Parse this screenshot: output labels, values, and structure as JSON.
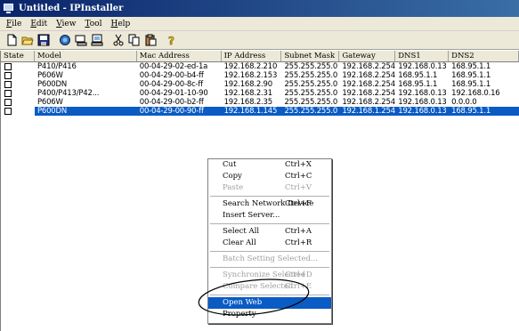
{
  "window": {
    "title": "Untitled - IPInstaller"
  },
  "menu": [
    {
      "label": "File"
    },
    {
      "label": "Edit"
    },
    {
      "label": "View"
    },
    {
      "label": "Tool"
    },
    {
      "label": "Help"
    }
  ],
  "toolbar": {
    "icons": [
      "new-file-icon",
      "open-folder-icon",
      "save-icon",
      "search-network-icon",
      "network-device-icon",
      "network-device-2-icon",
      "cut-icon",
      "copy-icon",
      "paste-icon",
      "help-icon"
    ]
  },
  "table": {
    "headers": [
      "State",
      "Model",
      "Mac Address",
      "IP Address",
      "Subnet Mask",
      "Gateway",
      "DNS1",
      "DNS2"
    ],
    "rows": [
      [
        "P410/P416",
        "00-04-29-02-ed-1a",
        "192.168.2.210",
        "255.255.255.0",
        "192.168.2.254",
        "192.168.0.13",
        "168.95.1.1"
      ],
      [
        "P606W",
        "00-04-29-00-b4-ff",
        "192.168.2.153",
        "255.255.255.0",
        "192.168.2.254",
        "168.95.1.1",
        "168.95.1.1"
      ],
      [
        "P600DN",
        "00-04-29-00-8c-ff",
        "192.168.2.90",
        "255.255.255.0",
        "192.168.2.254",
        "168.95.1.1",
        "168.95.1.1"
      ],
      [
        "P400/P413/P42...",
        "00-04-29-01-10-90",
        "192.168.2.31",
        "255.255.255.0",
        "192.168.2.254",
        "192.168.0.13",
        "192.168.0.16"
      ],
      [
        "P606W",
        "00-04-29-00-b2-ff",
        "192.168.2.35",
        "255.255.255.0",
        "192.168.2.254",
        "192.168.0.13",
        "0.0.0.0"
      ],
      [
        "P600DN",
        "00-04-29-00-90-ff",
        "192.168.1.145",
        "255.255.255.0",
        "192.168.1.254",
        "192.168.0.13",
        "168.95.1.1"
      ]
    ],
    "selected_row": 5
  },
  "context_menu": {
    "items": [
      {
        "label": "Cut",
        "shortcut": "Ctrl+X"
      },
      {
        "label": "Copy",
        "shortcut": "Ctrl+C"
      },
      {
        "label": "Paste",
        "shortcut": "Ctrl+V"
      },
      {
        "label": "Search Network Device",
        "shortcut": "Ctrl+F"
      },
      {
        "label": "Insert Server...",
        "shortcut": ""
      },
      {
        "label": "Select All",
        "shortcut": "Ctrl+A"
      },
      {
        "label": "Clear All",
        "shortcut": "Ctrl+R"
      },
      {
        "label": "Batch Setting Selected...",
        "shortcut": ""
      },
      {
        "label": "Synchronize Selected",
        "shortcut": "Ctrl+D"
      },
      {
        "label": "Compare Selected",
        "shortcut": "Ctrl+E"
      },
      {
        "label": "Open Web",
        "shortcut": ""
      },
      {
        "label": "Property",
        "shortcut": ""
      }
    ]
  },
  "colors": {
    "selection": "#0a5bc4",
    "titlebar": "#0a246a",
    "annotation": "#000000"
  }
}
